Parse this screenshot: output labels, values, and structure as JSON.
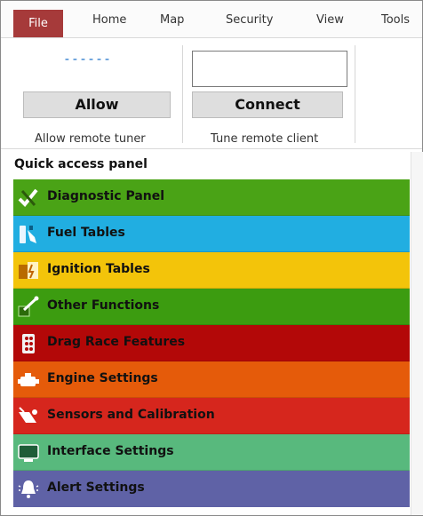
{
  "tabs": [
    {
      "label": "File"
    },
    {
      "label": "Home"
    },
    {
      "label": "Map"
    },
    {
      "label": "Security"
    },
    {
      "label": "View"
    },
    {
      "label": "Tools"
    }
  ],
  "remote_tuner": {
    "status_text": "------",
    "allow_label": "Allow",
    "group_label": "Allow remote tuner"
  },
  "remote_client": {
    "input_value": "",
    "connect_label": "Connect",
    "group_label": "Tune remote client"
  },
  "quick_access": {
    "title": "Quick access panel",
    "items": [
      {
        "label": "Diagnostic Panel",
        "color": "#4aa316",
        "icon": "diagnostic-icon"
      },
      {
        "label": "Fuel Tables",
        "color": "#21aee1",
        "icon": "fuel-icon"
      },
      {
        "label": "Ignition Tables",
        "color": "#f3c40a",
        "icon": "ignition-icon"
      },
      {
        "label": "Other Functions",
        "color": "#3c9c10",
        "icon": "wrench-icon"
      },
      {
        "label": "Drag Race Features",
        "color": "#b30808",
        "icon": "drag-race-icon"
      },
      {
        "label": "Engine Settings",
        "color": "#e55b0a",
        "icon": "engine-icon"
      },
      {
        "label": "Sensors and Calibration",
        "color": "#d6261d",
        "icon": "sensor-icon"
      },
      {
        "label": "Interface Settings",
        "color": "#58b97d",
        "icon": "monitor-icon"
      },
      {
        "label": "Alert Settings",
        "color": "#5f62a6",
        "icon": "bell-icon"
      }
    ]
  }
}
